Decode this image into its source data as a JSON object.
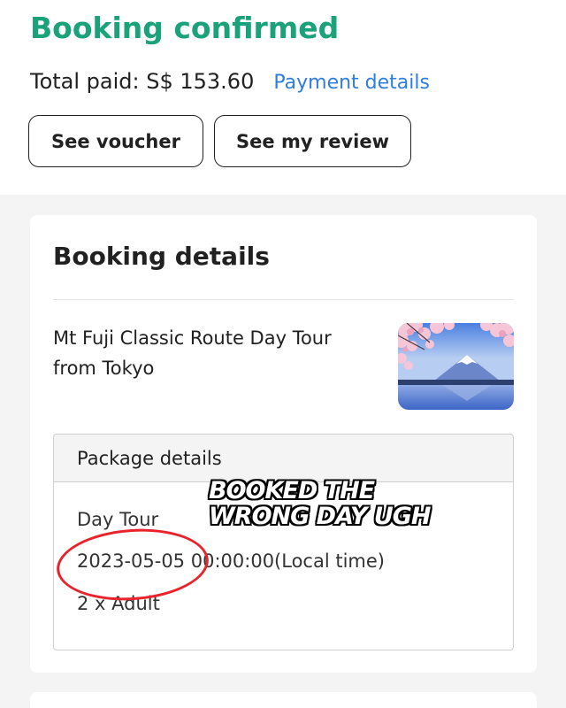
{
  "header": {
    "title": "Booking confirmed",
    "total_paid": "Total paid: S$ 153.60",
    "payment_link": "Payment details",
    "voucher_button": "See voucher",
    "review_button": "See my review"
  },
  "booking": {
    "section_title": "Booking details",
    "product_name": "Mt Fuji Classic Route Day Tour from Tokyo",
    "thumbnail_icon": "mt-fuji-cherry-blossom-photo",
    "package": {
      "header": "Package details",
      "type": "Day Tour",
      "date": "2023-05-05",
      "time": "00:00:00(Local time)",
      "quantity": "2 x Adult"
    }
  },
  "overlay": {
    "caption_line1": "BOOKED THE",
    "caption_line2": "WRONG DAY UGH",
    "circle_color": "#e8232c"
  },
  "colors": {
    "accent_green": "#1aa37a",
    "link_blue": "#2f7de1"
  }
}
